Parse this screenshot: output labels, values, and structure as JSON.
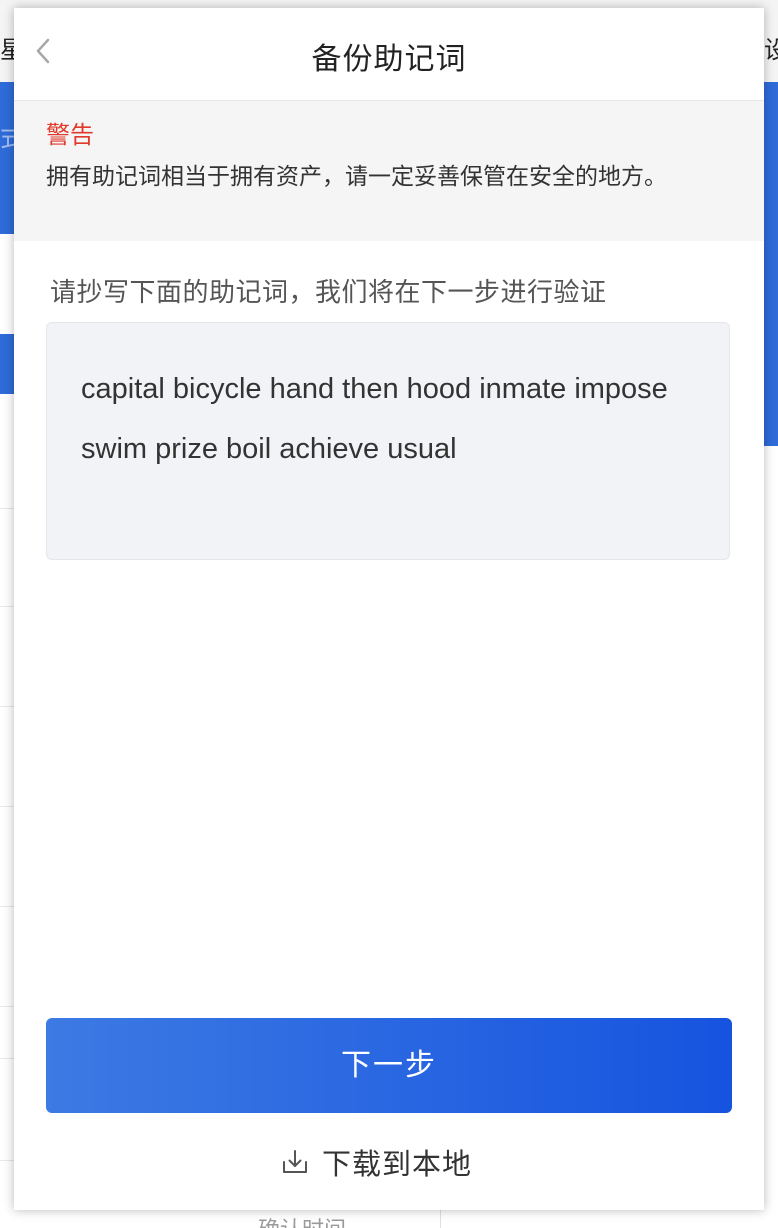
{
  "background": {
    "topbar_left_text": "星",
    "topbar_right_text": "设",
    "blue_panel_text": "式",
    "bottom_text": "确认时间"
  },
  "header": {
    "title": "备份助记词",
    "back_icon": "chevron-left-icon"
  },
  "warning": {
    "title": "警告",
    "text": "拥有助记词相当于拥有资产，请一定妥善保管在安全的地方。"
  },
  "instruction": "请抄写下面的助记词，我们将在下一步进行验证",
  "mnemonic": "capital bicycle hand then hood inmate impose swim prize boil achieve usual",
  "buttons": {
    "next_label": "下一步",
    "download_label": "下载到本地",
    "download_icon": "download-icon"
  },
  "colors": {
    "accent_start": "#3d7ae3",
    "accent_end": "#1654e0",
    "warning": "#e03a2a",
    "background_blue": "#2f6bd9"
  }
}
